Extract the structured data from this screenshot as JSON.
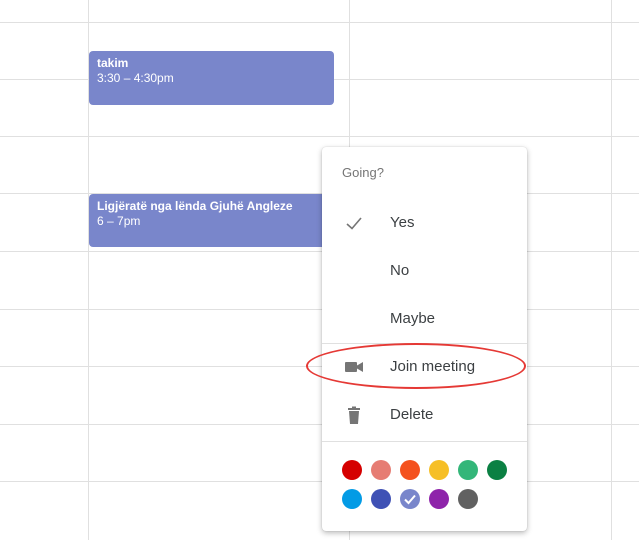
{
  "events": [
    {
      "title": "takim",
      "time": "3:30 – 4:30pm"
    },
    {
      "title": "Ligjëratë nga lënda Gjuhë Angleze",
      "time": "6 – 7pm"
    }
  ],
  "menu": {
    "heading": "Going?",
    "items": [
      {
        "label": "Yes",
        "icon": "check-icon"
      },
      {
        "label": "No"
      },
      {
        "label": "Maybe"
      },
      {
        "label": "Join meeting",
        "icon": "video-camera-icon"
      },
      {
        "label": "Delete",
        "icon": "trash-icon"
      }
    ],
    "colors": [
      "#d50000",
      "#e67c73",
      "#f4511e",
      "#f6bf26",
      "#33b679",
      "#0b8043",
      "#039be5",
      "#3f51b5",
      "#7986cb",
      "#8e24aa",
      "#616161"
    ],
    "selected_color": "#7986cb"
  }
}
